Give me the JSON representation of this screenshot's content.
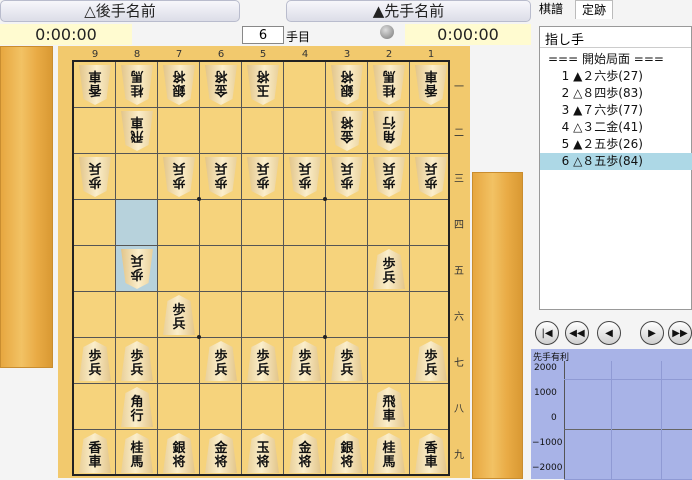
{
  "players": {
    "gote_name": "△後手名前",
    "sente_name": "▲先手名前",
    "gote_clock": "0:00:00",
    "sente_clock": "0:00:00"
  },
  "move_counter": {
    "value": "6",
    "suffix": "手目"
  },
  "tabs": [
    "棋譜",
    "定跡"
  ],
  "move_list": {
    "header": "指し手",
    "items": [
      "=== 開始局面 ===",
      "  1 ▲２六歩(27)",
      "  2 △８四歩(83)",
      "  3 ▲７六歩(77)",
      "  4 △３二金(41)",
      "  5 ▲２五歩(26)",
      "  6 △８五歩(84)"
    ],
    "selected_index": 6
  },
  "eval_graph": {
    "title": "先手有利",
    "labels": [
      "2000",
      "1000",
      "0",
      "−1000",
      "−2000"
    ]
  },
  "board": {
    "file_labels": [
      "9",
      "8",
      "7",
      "6",
      "5",
      "4",
      "3",
      "2",
      "1"
    ],
    "rank_labels": [
      "一",
      "二",
      "三",
      "四",
      "五",
      "六",
      "七",
      "八",
      "九"
    ],
    "highlight": [
      [
        "8",
        "四"
      ],
      [
        "8",
        "五"
      ]
    ],
    "pieces": [
      {
        "f": 9,
        "r": 1,
        "t": "香車",
        "side": "gote"
      },
      {
        "f": 8,
        "r": 1,
        "t": "桂馬",
        "side": "gote"
      },
      {
        "f": 7,
        "r": 1,
        "t": "銀将",
        "side": "gote"
      },
      {
        "f": 6,
        "r": 1,
        "t": "金将",
        "side": "gote"
      },
      {
        "f": 5,
        "r": 1,
        "t": "玉将",
        "side": "gote"
      },
      {
        "f": 3,
        "r": 1,
        "t": "銀将",
        "side": "gote"
      },
      {
        "f": 2,
        "r": 1,
        "t": "桂馬",
        "side": "gote"
      },
      {
        "f": 1,
        "r": 1,
        "t": "香車",
        "side": "gote"
      },
      {
        "f": 8,
        "r": 2,
        "t": "飛車",
        "side": "gote"
      },
      {
        "f": 3,
        "r": 2,
        "t": "金将",
        "side": "gote"
      },
      {
        "f": 2,
        "r": 2,
        "t": "角行",
        "side": "gote"
      },
      {
        "f": 9,
        "r": 3,
        "t": "歩兵",
        "side": "gote"
      },
      {
        "f": 7,
        "r": 3,
        "t": "歩兵",
        "side": "gote"
      },
      {
        "f": 6,
        "r": 3,
        "t": "歩兵",
        "side": "gote"
      },
      {
        "f": 5,
        "r": 3,
        "t": "歩兵",
        "side": "gote"
      },
      {
        "f": 4,
        "r": 3,
        "t": "歩兵",
        "side": "gote"
      },
      {
        "f": 3,
        "r": 3,
        "t": "歩兵",
        "side": "gote"
      },
      {
        "f": 2,
        "r": 3,
        "t": "歩兵",
        "side": "gote"
      },
      {
        "f": 1,
        "r": 3,
        "t": "歩兵",
        "side": "gote"
      },
      {
        "f": 8,
        "r": 5,
        "t": "歩兵",
        "side": "gote"
      },
      {
        "f": 2,
        "r": 5,
        "t": "歩兵",
        "side": "sente"
      },
      {
        "f": 7,
        "r": 6,
        "t": "歩兵",
        "side": "sente"
      },
      {
        "f": 9,
        "r": 7,
        "t": "歩兵",
        "side": "sente"
      },
      {
        "f": 8,
        "r": 7,
        "t": "歩兵",
        "side": "sente"
      },
      {
        "f": 6,
        "r": 7,
        "t": "歩兵",
        "side": "sente"
      },
      {
        "f": 5,
        "r": 7,
        "t": "歩兵",
        "side": "sente"
      },
      {
        "f": 4,
        "r": 7,
        "t": "歩兵",
        "side": "sente"
      },
      {
        "f": 3,
        "r": 7,
        "t": "歩兵",
        "side": "sente"
      },
      {
        "f": 1,
        "r": 7,
        "t": "歩兵",
        "side": "sente"
      },
      {
        "f": 8,
        "r": 8,
        "t": "角行",
        "side": "sente"
      },
      {
        "f": 2,
        "r": 8,
        "t": "飛車",
        "side": "sente"
      },
      {
        "f": 9,
        "r": 9,
        "t": "香車",
        "side": "sente"
      },
      {
        "f": 8,
        "r": 9,
        "t": "桂馬",
        "side": "sente"
      },
      {
        "f": 7,
        "r": 9,
        "t": "銀将",
        "side": "sente"
      },
      {
        "f": 6,
        "r": 9,
        "t": "金将",
        "side": "sente"
      },
      {
        "f": 5,
        "r": 9,
        "t": "玉将",
        "side": "sente"
      },
      {
        "f": 4,
        "r": 9,
        "t": "金将",
        "side": "sente"
      },
      {
        "f": 3,
        "r": 9,
        "t": "銀将",
        "side": "sente"
      },
      {
        "f": 2,
        "r": 9,
        "t": "桂馬",
        "side": "sente"
      },
      {
        "f": 1,
        "r": 9,
        "t": "香車",
        "side": "sente"
      }
    ]
  },
  "nav_buttons": [
    "first-icon",
    "prev-many-icon",
    "prev-icon",
    "next-icon",
    "next-many-icon"
  ]
}
